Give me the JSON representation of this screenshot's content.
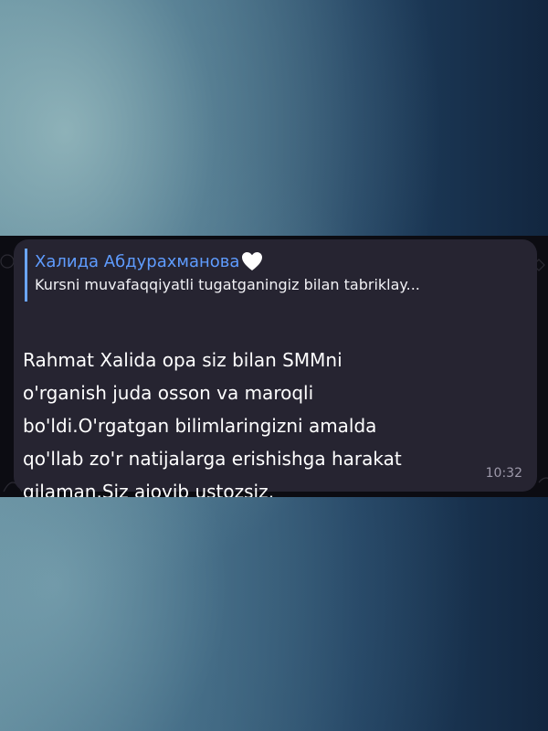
{
  "chat": {
    "reply": {
      "name": "Халида Абдурахманова",
      "text": "Kursni muvafaqqiyatli tugatganingiz bilan tabriklay..."
    },
    "message": {
      "text": "Rahmat Xalida opa siz bilan SMMni\no'rganish juda osson va maroqli\nbo'ldi.O'rgatgan bilimlaringizni amalda\nqo'llab zo'r natijalarga erishishga harakat\nqilaman.Siz ajoyib ustozsiz,",
      "time": "10:32"
    },
    "emojis": [
      "smiling-face-with-hearts-icon",
      "smiling-face-with-hearts-icon",
      "smiling-face-with-hearts-icon",
      "face-blowing-kiss-icon"
    ],
    "colors": {
      "reply_accent": "#6aa5ff",
      "bubble_bg": "#262431",
      "strip_bg": "#0c0c12"
    }
  }
}
